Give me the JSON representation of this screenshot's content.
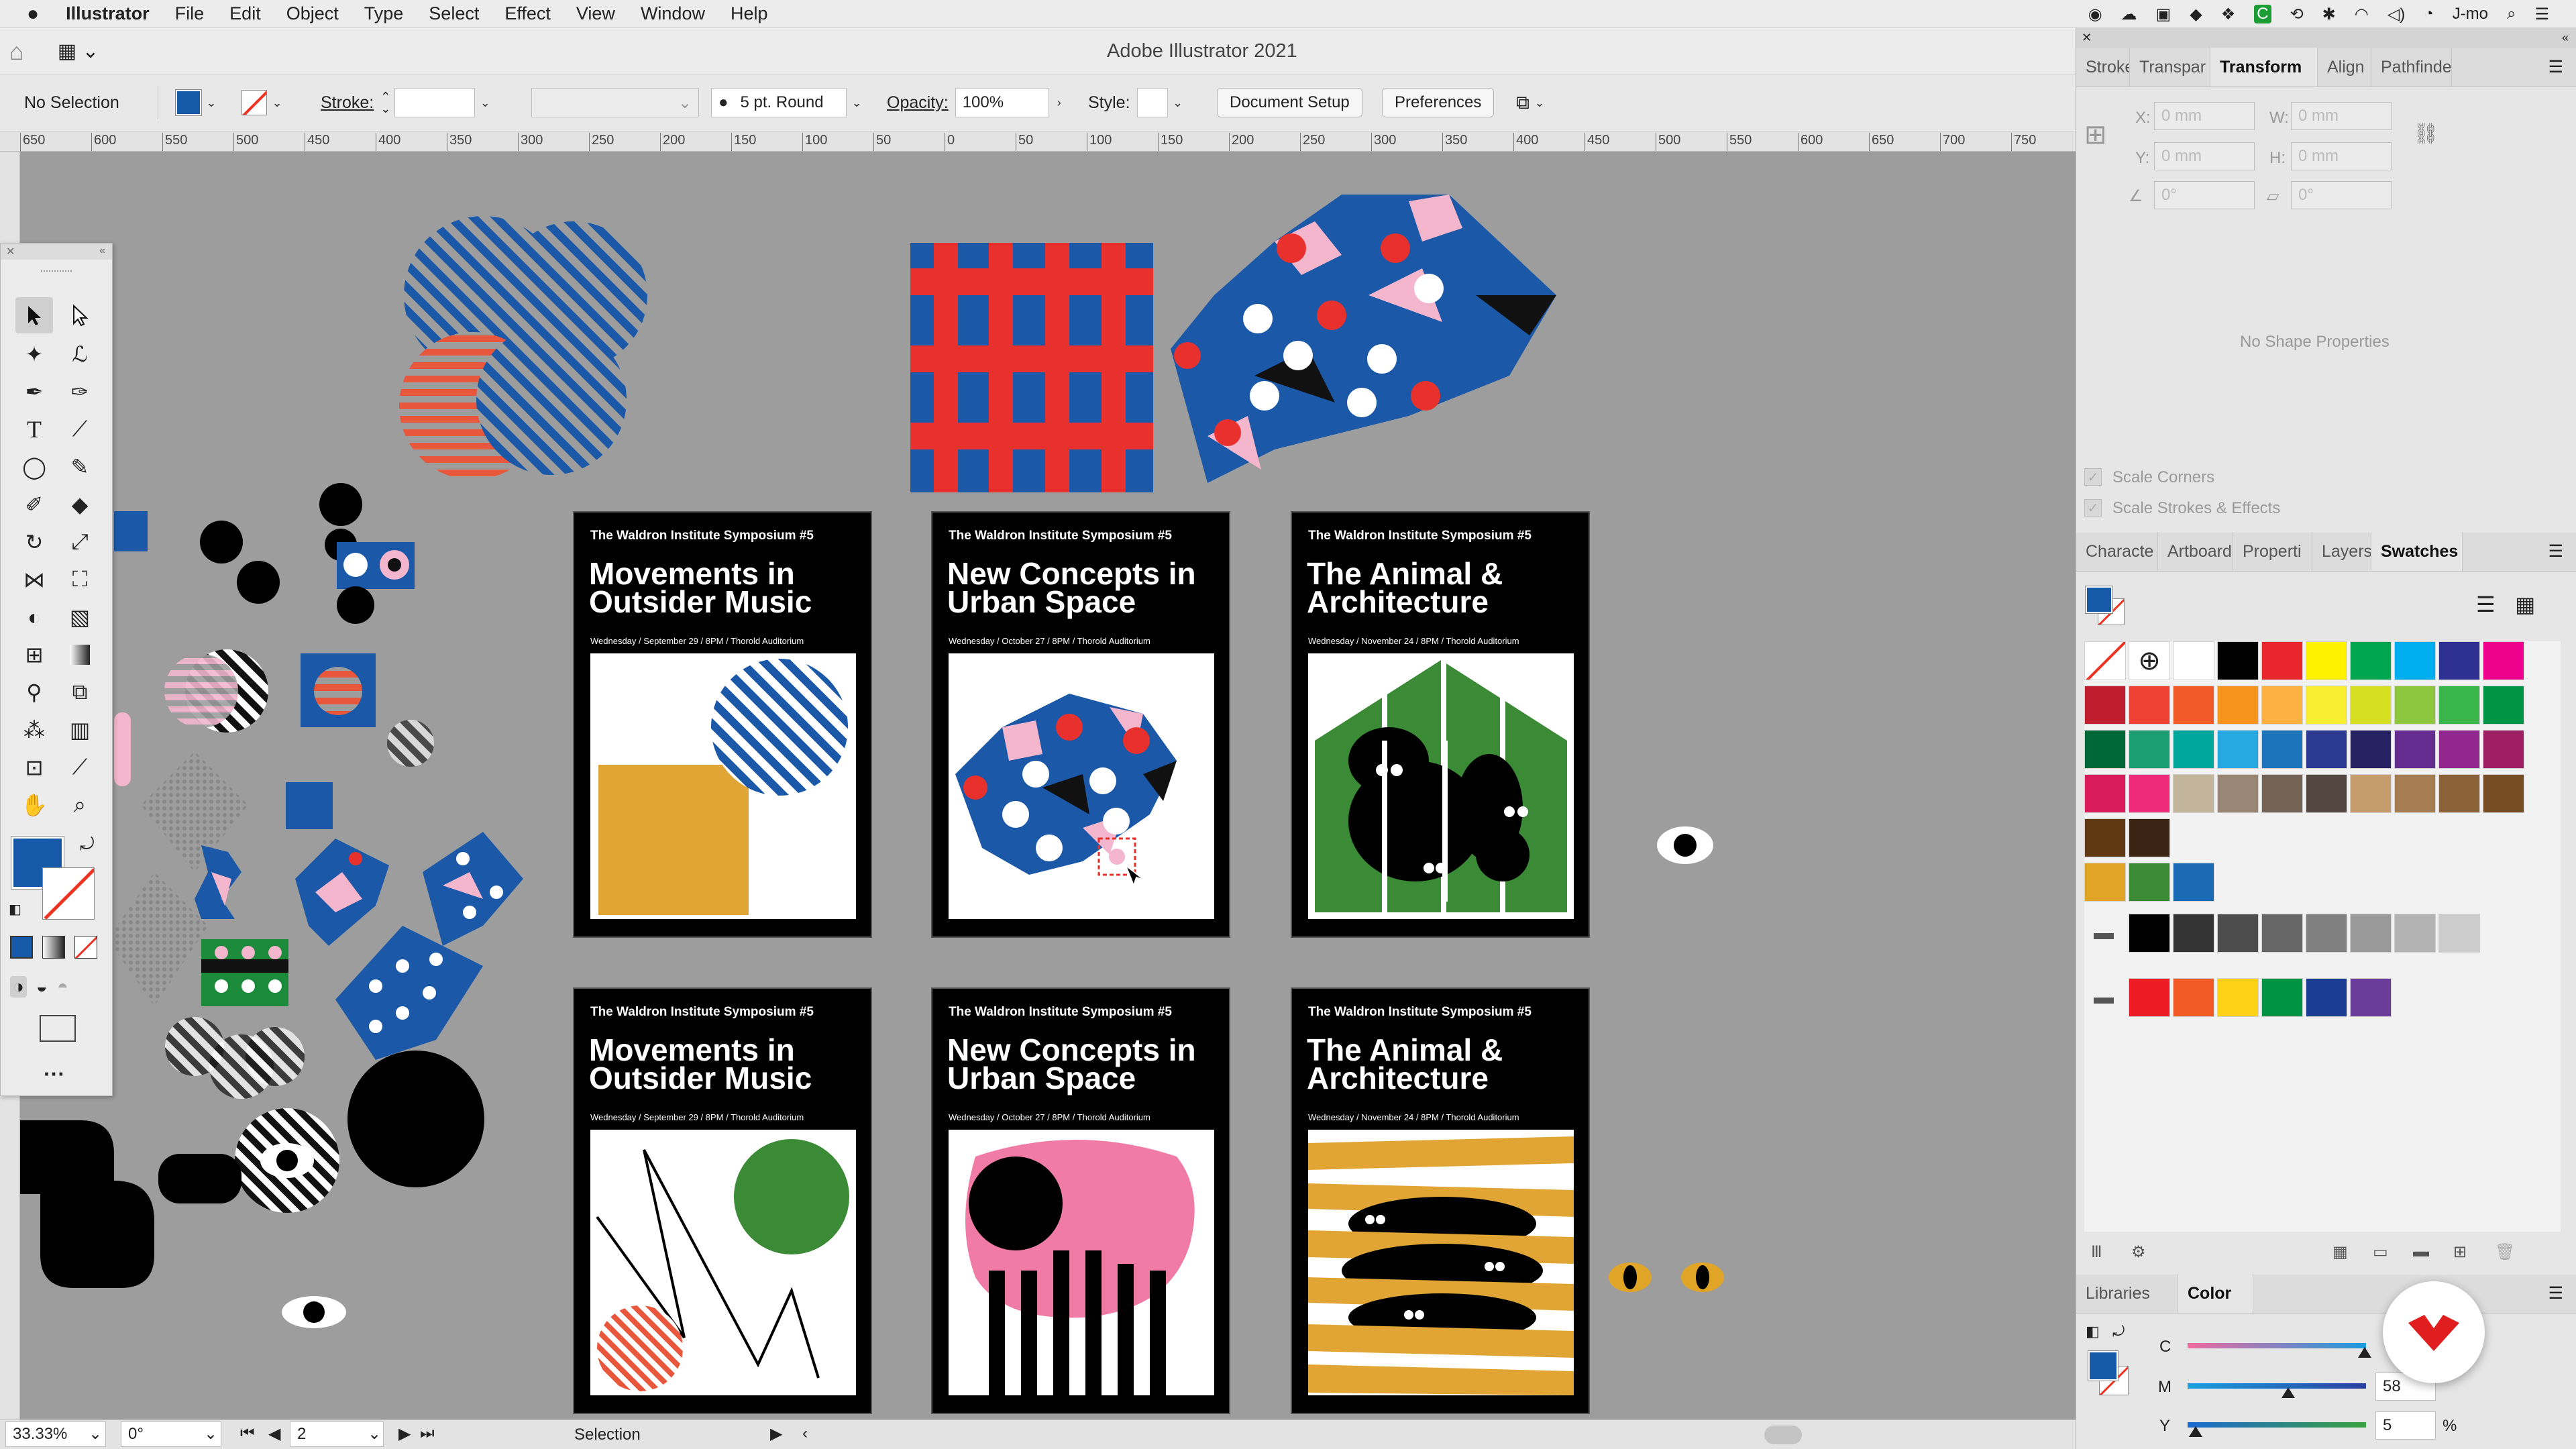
{
  "menubar": {
    "app": "Illustrator",
    "items": [
      "File",
      "Edit",
      "Object",
      "Type",
      "Select",
      "Effect",
      "View",
      "Window",
      "Help"
    ],
    "user": "J-mo"
  },
  "window": {
    "title": "Adobe Illustrator 2021"
  },
  "control": {
    "selection": "No Selection",
    "stroke_label": "Stroke:",
    "brush": "5 pt. Round",
    "opacity_label": "Opacity:",
    "opacity_value": "100%",
    "style_label": "Style:",
    "doc_setup": "Document Setup",
    "preferences": "Preferences"
  },
  "rulers": {
    "top": [
      "650",
      "600",
      "550",
      "500",
      "450",
      "400",
      "350",
      "300",
      "250",
      "200",
      "150",
      "100",
      "50",
      "0",
      "50",
      "100",
      "150",
      "200",
      "250",
      "300",
      "350",
      "400",
      "450",
      "500",
      "550",
      "600",
      "650",
      "700",
      "750"
    ]
  },
  "posters": [
    {
      "head": "The Waldron Institute Symposium #5",
      "title": "Movements in Outsider Music",
      "sub": "Wednesday / September 29 / 8PM / Thorold Auditorium"
    },
    {
      "head": "The Waldron Institute Symposium #5",
      "title": "New Concepts in Urban Space",
      "sub": "Wednesday / October 27 / 8PM / Thorold Auditorium"
    },
    {
      "head": "The Waldron Institute Symposium #5",
      "title": "The Animal & Architecture",
      "sub": "Wednesday / November 24 / 8PM / Thorold Auditorium"
    },
    {
      "head": "The Waldron Institute Symposium #5",
      "title": "Movements in Outsider Music",
      "sub": "Wednesday / September 29 / 8PM / Thorold Auditorium"
    },
    {
      "head": "The Waldron Institute Symposium #5",
      "title": "New Concepts in Urban Space",
      "sub": "Wednesday / October 27 / 8PM / Thorold Auditorium"
    },
    {
      "head": "The Waldron Institute Symposium #5",
      "title": "The Animal & Architecture",
      "sub": "Wednesday / November 24 / 8PM / Thorold Auditorium"
    }
  ],
  "status": {
    "zoom": "33.33%",
    "rotation": "0°",
    "artboard": "2",
    "tool": "Selection"
  },
  "panel_top": {
    "tabs": [
      "Stroke",
      "Transpar",
      "Transform",
      "Align",
      "Pathfinde"
    ],
    "active": "Transform",
    "x_label": "X:",
    "y_label": "Y:",
    "w_label": "W:",
    "h_label": "H:",
    "x": "0 mm",
    "y": "0 mm",
    "w": "0 mm",
    "h": "0 mm",
    "angle": "0°",
    "shear": "0°",
    "no_shape": "No Shape Properties",
    "scale_corners": "Scale Corners",
    "scale_strokes": "Scale Strokes & Effects"
  },
  "panel_mid": {
    "tabs": [
      "Characte",
      "Artboard",
      "Properti",
      "Layers",
      "Swatches"
    ],
    "active": "Swatches",
    "swatch_rows": [
      [
        "#ffffff",
        "#000000",
        "#e8262b",
        "#fef200",
        "#00a650",
        "#00adef",
        "#2e3192",
        "#ec008c"
      ],
      [
        "#be1e2d",
        "#ef4136",
        "#f15a29",
        "#f7941d",
        "#fbb040",
        "#f9ed32",
        "#d7df23",
        "#8dc63f",
        "#39b54a",
        "#009444"
      ],
      [
        "#006838",
        "#1c9e73",
        "#00a79d",
        "#27aae1",
        "#1c75bc",
        "#2b3990",
        "#262262",
        "#662d91",
        "#92278f",
        "#9e1f63"
      ],
      [
        "#da1c5c",
        "#ee2a7b",
        "#c2b59b",
        "#998675",
        "#736357",
        "#534741",
        "#c69c6d",
        "#a67c52",
        "#8c6239",
        "#754c24"
      ],
      [
        "#603913",
        "#3c2415"
      ],
      [
        "#e0a526",
        "#3b8a35",
        "#1b6ab5"
      ],
      [
        "#000000",
        "#333333",
        "#4d4d4d",
        "#666666",
        "#808080",
        "#999999",
        "#b3b3b3",
        "#cccccc"
      ],
      [
        "#ed1c24",
        "#f15a24",
        "#fcd116",
        "#009245",
        "#1b3d94",
        "#6a3d9a"
      ]
    ]
  },
  "panel_bottom": {
    "tabs": [
      "Libraries",
      "Color"
    ],
    "active": "Color",
    "c_label": "C",
    "m_label": "M",
    "y_label": "Y",
    "m_value": "58",
    "y_value": "5",
    "pct": "%"
  }
}
